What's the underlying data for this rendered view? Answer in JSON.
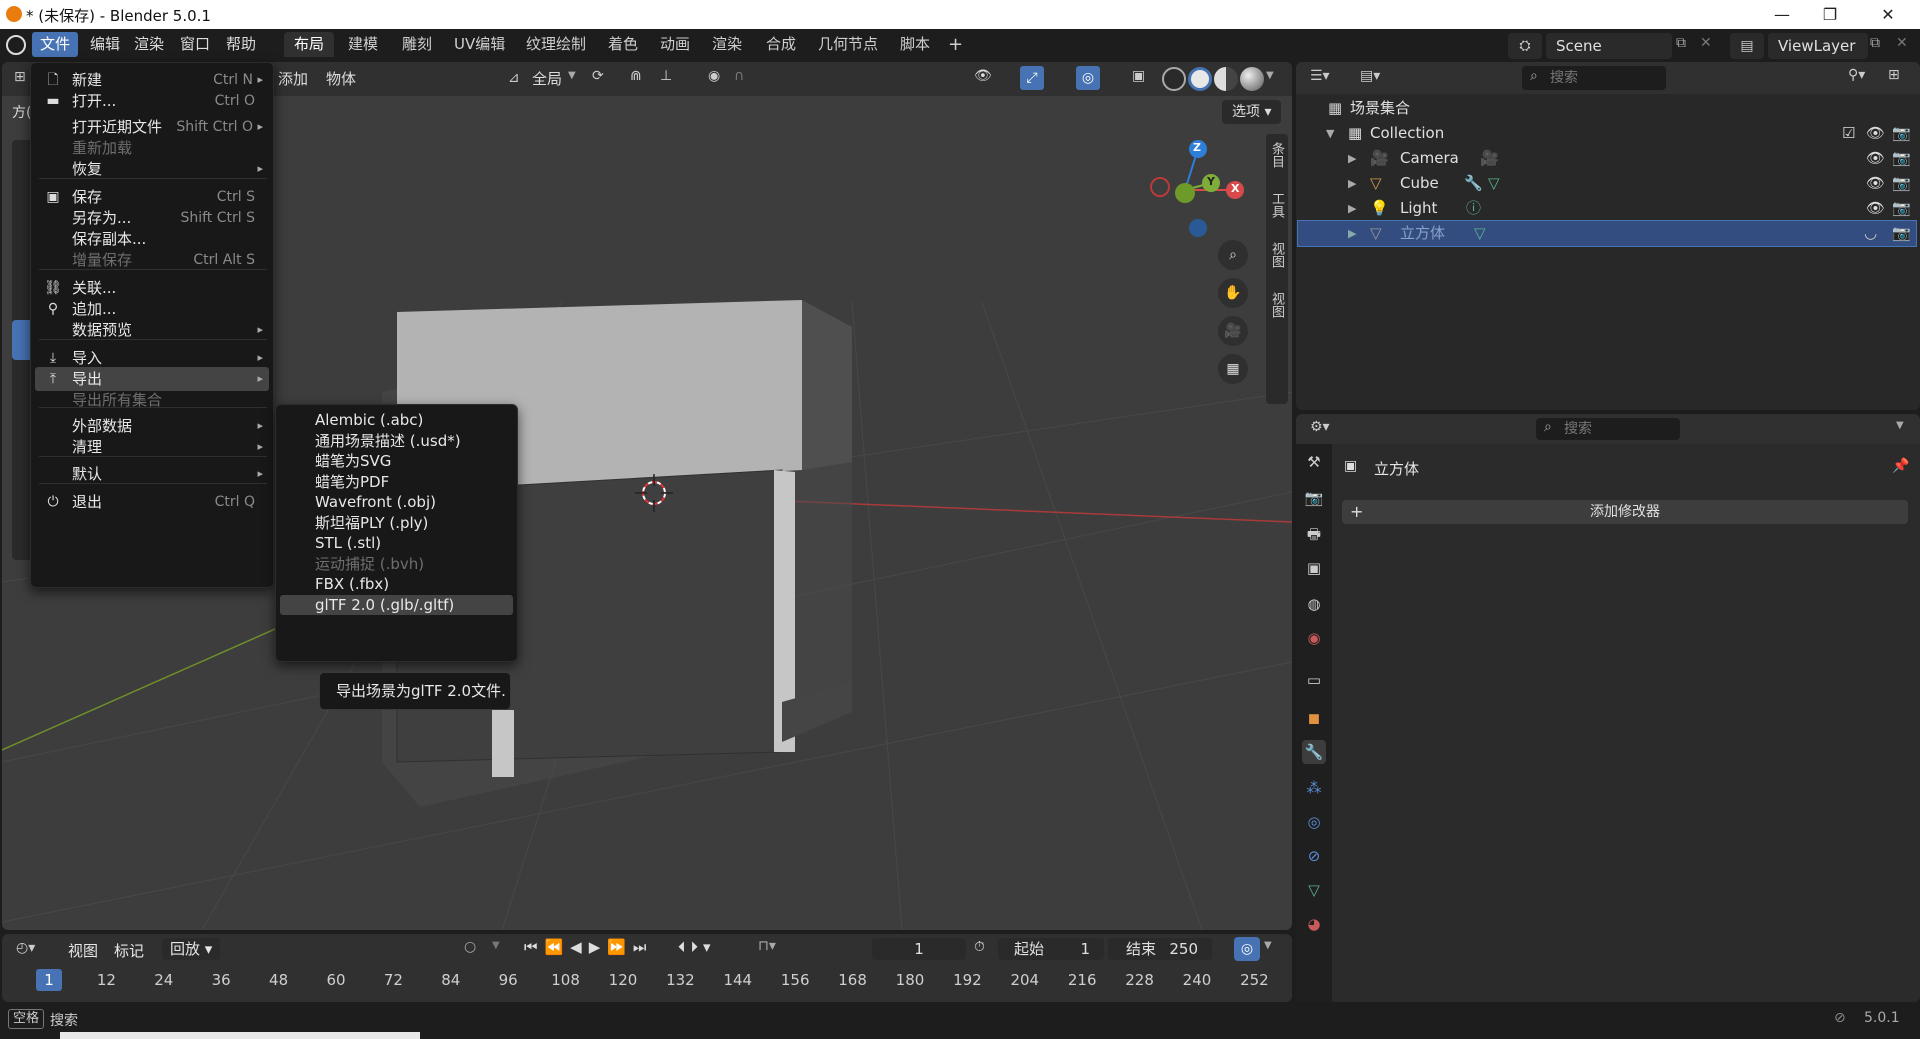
{
  "window": {
    "title": "* (未保存) - Blender 5.0.1",
    "minimize": "—",
    "maximize": "❐",
    "close": "✕"
  },
  "menubar": {
    "items": [
      "文件",
      "编辑",
      "渲染",
      "窗口",
      "帮助"
    ],
    "workspaces": [
      "布局",
      "建模",
      "雕刻",
      "UV编辑",
      "纹理绘制",
      "着色",
      "动画",
      "渲染",
      "合成",
      "几何节点",
      "脚本"
    ],
    "add_tab": "+",
    "scene": "Scene",
    "view_layer": "ViewLayer"
  },
  "viewport": {
    "menus": [
      "添加",
      "物体"
    ],
    "transform_orientation": "全局",
    "options": "选项",
    "side_tabs": [
      "条目",
      "工具",
      "视图"
    ],
    "left_cut_label": "方(",
    "gizmo": {
      "x": "X",
      "y": "Y",
      "z": "Z"
    }
  },
  "file_menu": {
    "items": [
      {
        "icon": "new-file-icon",
        "glyph": "🗋",
        "label": "新建",
        "shortcut": "Ctrl N",
        "arrow": "▸",
        "disabled": false
      },
      {
        "icon": "folder-icon",
        "glyph": "▬",
        "label": "打开...",
        "shortcut": "Ctrl O",
        "arrow": "",
        "disabled": false
      },
      {
        "icon": "",
        "glyph": "",
        "label": "打开近期文件",
        "shortcut": "Shift Ctrl O",
        "arrow": "▸",
        "disabled": false
      },
      {
        "icon": "",
        "glyph": "",
        "label": "重新加载",
        "shortcut": "",
        "arrow": "",
        "disabled": true
      },
      {
        "icon": "",
        "glyph": "",
        "label": "恢复",
        "shortcut": "",
        "arrow": "▸",
        "disabled": false
      },
      {
        "icon": "save-icon",
        "glyph": "▣",
        "label": "保存",
        "shortcut": "Ctrl S",
        "arrow": "",
        "disabled": false
      },
      {
        "icon": "",
        "glyph": "",
        "label": "另存为...",
        "shortcut": "Shift Ctrl S",
        "arrow": "",
        "disabled": false
      },
      {
        "icon": "",
        "glyph": "",
        "label": "保存副本...",
        "shortcut": "",
        "arrow": "",
        "disabled": false
      },
      {
        "icon": "",
        "glyph": "",
        "label": "增量保存",
        "shortcut": "Ctrl Alt S",
        "arrow": "",
        "disabled": true
      },
      {
        "icon": "link-icon",
        "glyph": "⛓",
        "label": "关联...",
        "shortcut": "",
        "arrow": "",
        "disabled": false
      },
      {
        "icon": "append-icon",
        "glyph": "⚲",
        "label": "追加...",
        "shortcut": "",
        "arrow": "",
        "disabled": false
      },
      {
        "icon": "",
        "glyph": "",
        "label": "数据预览",
        "shortcut": "",
        "arrow": "▸",
        "disabled": false
      },
      {
        "icon": "import-icon",
        "glyph": "⤓",
        "label": "导入",
        "shortcut": "",
        "arrow": "▸",
        "disabled": false
      },
      {
        "icon": "export-icon",
        "glyph": "⤒",
        "label": "导出",
        "shortcut": "",
        "arrow": "▸",
        "disabled": false
      },
      {
        "icon": "",
        "glyph": "",
        "label": "导出所有集合",
        "shortcut": "",
        "arrow": "",
        "disabled": true
      },
      {
        "icon": "",
        "glyph": "",
        "label": "外部数据",
        "shortcut": "",
        "arrow": "▸",
        "disabled": false
      },
      {
        "icon": "",
        "glyph": "",
        "label": "清理",
        "shortcut": "",
        "arrow": "▸",
        "disabled": false
      },
      {
        "icon": "",
        "glyph": "",
        "label": "默认",
        "shortcut": "",
        "arrow": "▸",
        "disabled": false
      },
      {
        "icon": "quit-icon",
        "glyph": "⏻",
        "label": "退出",
        "shortcut": "Ctrl Q",
        "arrow": "",
        "disabled": false
      }
    ]
  },
  "export_menu": {
    "items": [
      {
        "label": "Alembic (.abc)",
        "disabled": false
      },
      {
        "label": "通用场景描述 (.usd*)",
        "disabled": false
      },
      {
        "label": "蜡笔为SVG",
        "disabled": false
      },
      {
        "label": "蜡笔为PDF",
        "disabled": false
      },
      {
        "label": "Wavefront (.obj)",
        "disabled": false
      },
      {
        "label": "斯坦福PLY (.ply)",
        "disabled": false
      },
      {
        "label": "STL (.stl)",
        "disabled": false
      },
      {
        "label": "运动捕捉 (.bvh)",
        "disabled": true
      },
      {
        "label": "FBX (.fbx)",
        "disabled": false
      },
      {
        "label": "glTF 2.0 (.glb/.gltf)",
        "disabled": false
      }
    ],
    "tooltip": "导出场景为glTF 2.0文件."
  },
  "outliner": {
    "search_placeholder": "搜索",
    "root": "场景集合",
    "collection": "Collection",
    "objects": [
      {
        "name": "Camera",
        "color": "#d99a4a"
      },
      {
        "name": "Cube",
        "color": "#d99a4a"
      },
      {
        "name": "Light",
        "color": "#d99a4a"
      },
      {
        "name": "立方体",
        "color": "#d99a4a"
      }
    ]
  },
  "properties": {
    "search_placeholder": "搜索",
    "object_name": "立方体",
    "add_modifier": "添加修改器"
  },
  "timeline": {
    "menus": [
      "视图",
      "标记",
      "回放"
    ],
    "current_frame": "1",
    "start_label": "起始",
    "start": "1",
    "end_label": "结束",
    "end": "250",
    "ticks": [
      "1",
      "12",
      "24",
      "36",
      "48",
      "60",
      "72",
      "84",
      "96",
      "108",
      "120",
      "132",
      "144",
      "156",
      "168",
      "180",
      "192",
      "204",
      "216",
      "228",
      "240",
      "252"
    ]
  },
  "status": {
    "key": "空格",
    "action": "搜索",
    "version": "5.0.1"
  },
  "colors": {
    "accent": "#4772b3",
    "x_axis": "#d84a4a",
    "y_axis": "#7fad3a",
    "z_axis": "#2f7fd8"
  }
}
